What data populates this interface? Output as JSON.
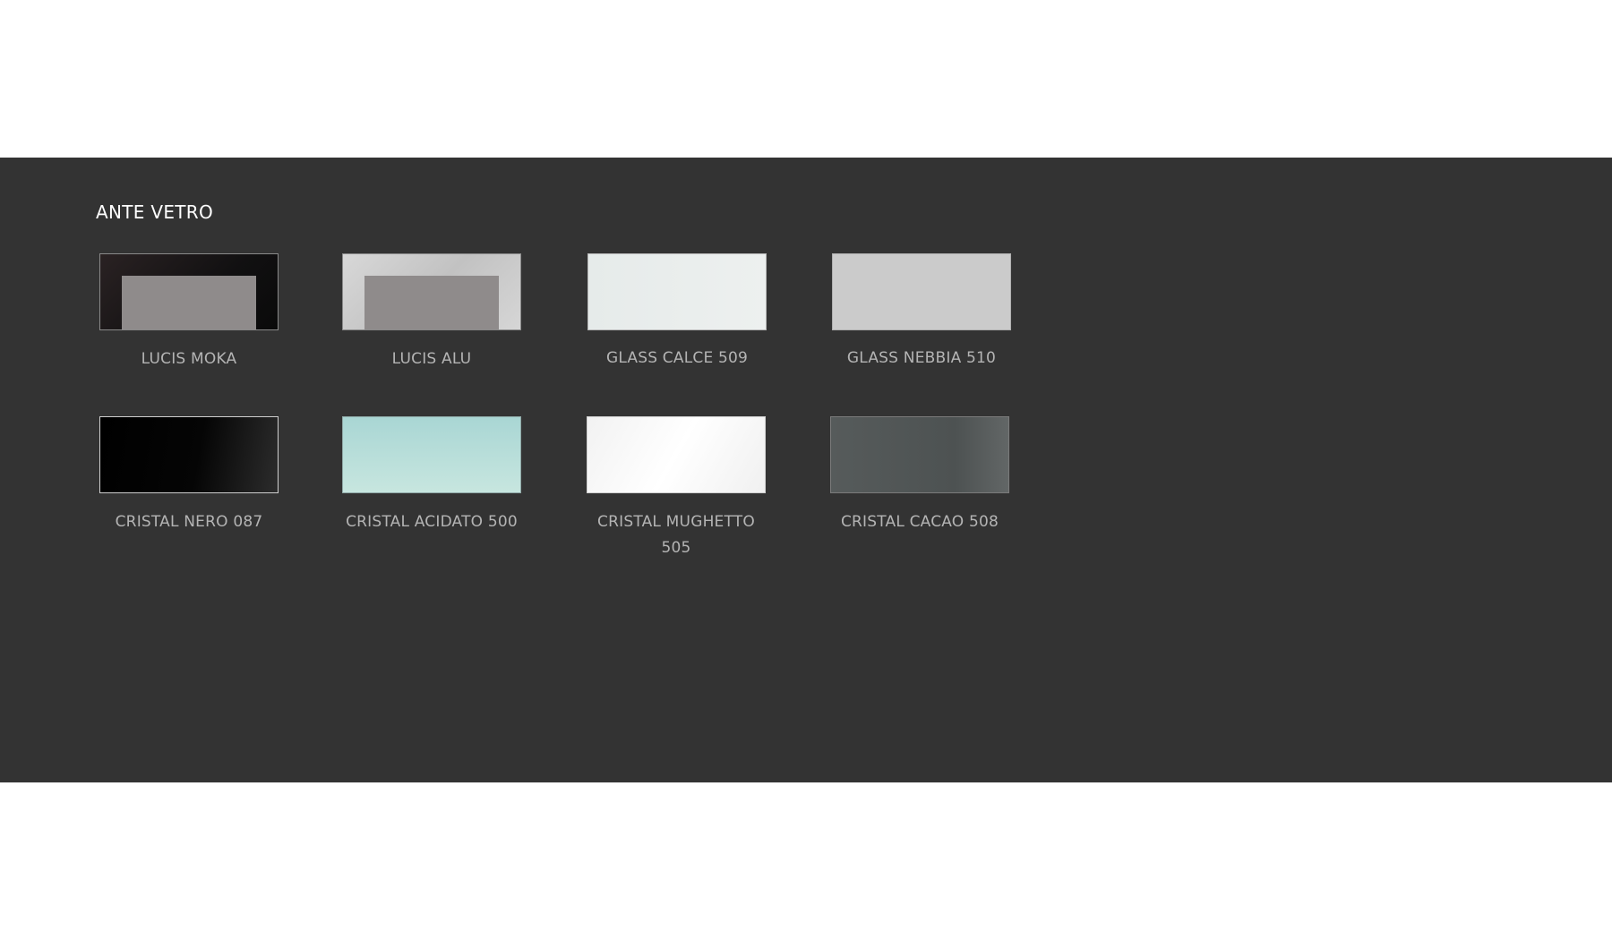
{
  "section": {
    "title": "ANTE VETRO"
  },
  "swatches": [
    {
      "label": "LUCIS MOKA"
    },
    {
      "label": "LUCIS ALU"
    },
    {
      "label": "GLASS CALCE 509"
    },
    {
      "label": "GLASS NEBBIA 510"
    },
    {
      "label": "CRISTAL NERO 087"
    },
    {
      "label": "CRISTAL ACIDATO 500"
    },
    {
      "label": "CRISTAL MUGHETTO 505"
    },
    {
      "label": "CRISTAL CACAO 508"
    }
  ],
  "colors": {
    "section_background": "#333333",
    "page_background": "#ffffff",
    "title_text": "#ffffff",
    "label_text": "#b4b4b4"
  }
}
